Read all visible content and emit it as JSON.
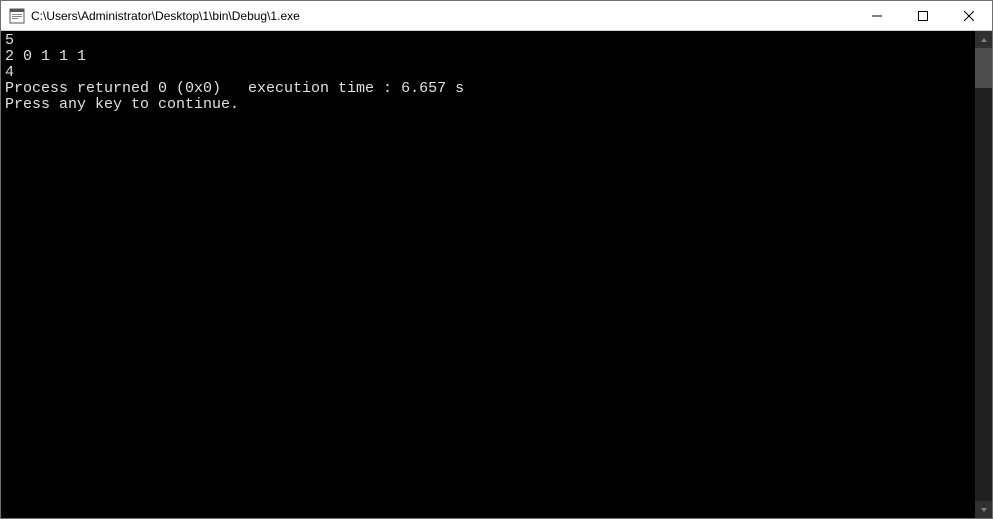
{
  "window": {
    "title": "C:\\Users\\Administrator\\Desktop\\1\\bin\\Debug\\1.exe"
  },
  "console": {
    "lines": [
      "5",
      "2 0 1 1 1",
      "4",
      "",
      "Process returned 0 (0x0)   execution time : 6.657 s",
      "Press any key to continue."
    ]
  }
}
